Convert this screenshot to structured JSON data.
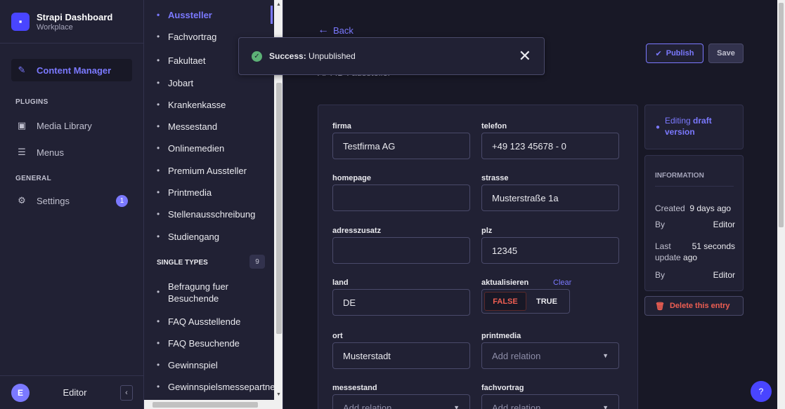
{
  "brand": {
    "title": "Strapi Dashboard",
    "subtitle": "Workplace",
    "logo_glyph": "▪"
  },
  "nav": {
    "content_manager": "Content Manager",
    "plugins_label": "PLUGINS",
    "media_library": "Media Library",
    "menus": "Menus",
    "general_label": "GENERAL",
    "settings": "Settings",
    "settings_badge": "1"
  },
  "user": {
    "initial": "E",
    "name": "Editor"
  },
  "collection_types": [
    "Aussteller",
    "Fachvortrag",
    "Fakultaet",
    "Jobart",
    "Krankenkasse",
    "Messestand",
    "Onlinemedien",
    "Premium Aussteller",
    "Printmedia",
    "Stellenausschreibung",
    "Studiengang"
  ],
  "active_collection": "Aussteller",
  "single_types": {
    "label": "SINGLE TYPES",
    "count": "9",
    "items": [
      "Befragung fuer Besuchende",
      "FAQ Ausstellende",
      "FAQ Besuchende",
      "Gewinnspiel",
      "Gewinnspielsmessepartner"
    ]
  },
  "header": {
    "back": "Back",
    "subtitle": "API ID : aussteller"
  },
  "actions": {
    "publish": "Publish",
    "save": "Save",
    "delete": "Delete this entry"
  },
  "toast": {
    "status": "Success:",
    "message": "Unpublished"
  },
  "fields": {
    "firma": {
      "label": "firma",
      "value": "Testfirma AG"
    },
    "telefon": {
      "label": "telefon",
      "value": "+49 123 45678 - 0"
    },
    "homepage": {
      "label": "homepage",
      "value": ""
    },
    "strasse": {
      "label": "strasse",
      "value": "Musterstraße 1a"
    },
    "adresszusatz": {
      "label": "adresszusatz",
      "value": ""
    },
    "plz": {
      "label": "plz",
      "value": "12345"
    },
    "land": {
      "label": "land",
      "value": "DE"
    },
    "aktualisieren": {
      "label": "aktualisieren",
      "clear": "Clear",
      "off": "FALSE",
      "on": "TRUE",
      "value": "FALSE"
    },
    "ort": {
      "label": "ort",
      "value": "Musterstadt"
    },
    "printmedia": {
      "label": "printmedia",
      "placeholder": "Add relation"
    },
    "messestand": {
      "label": "messestand",
      "placeholder": "Add relation"
    },
    "fachvortrag": {
      "label": "fachvortrag",
      "placeholder": "Add relation"
    }
  },
  "status": {
    "prefix": "Editing",
    "highlight": "draft version"
  },
  "info": {
    "title": "INFORMATION",
    "created_label": "Created",
    "created_value": "9 days ago",
    "by_label": "By",
    "created_by": "Editor",
    "updated_label_1": "Last",
    "updated_label_2": "update",
    "updated_value_1": "51 seconds",
    "updated_value_2": "ago",
    "updated_by": "Editor"
  },
  "colors": {
    "accent": "#7b79ff",
    "primary": "#4945ff",
    "danger": "#ee5e52",
    "success": "#5cb176",
    "background": "#181826",
    "surface": "#212134"
  },
  "help": "?"
}
